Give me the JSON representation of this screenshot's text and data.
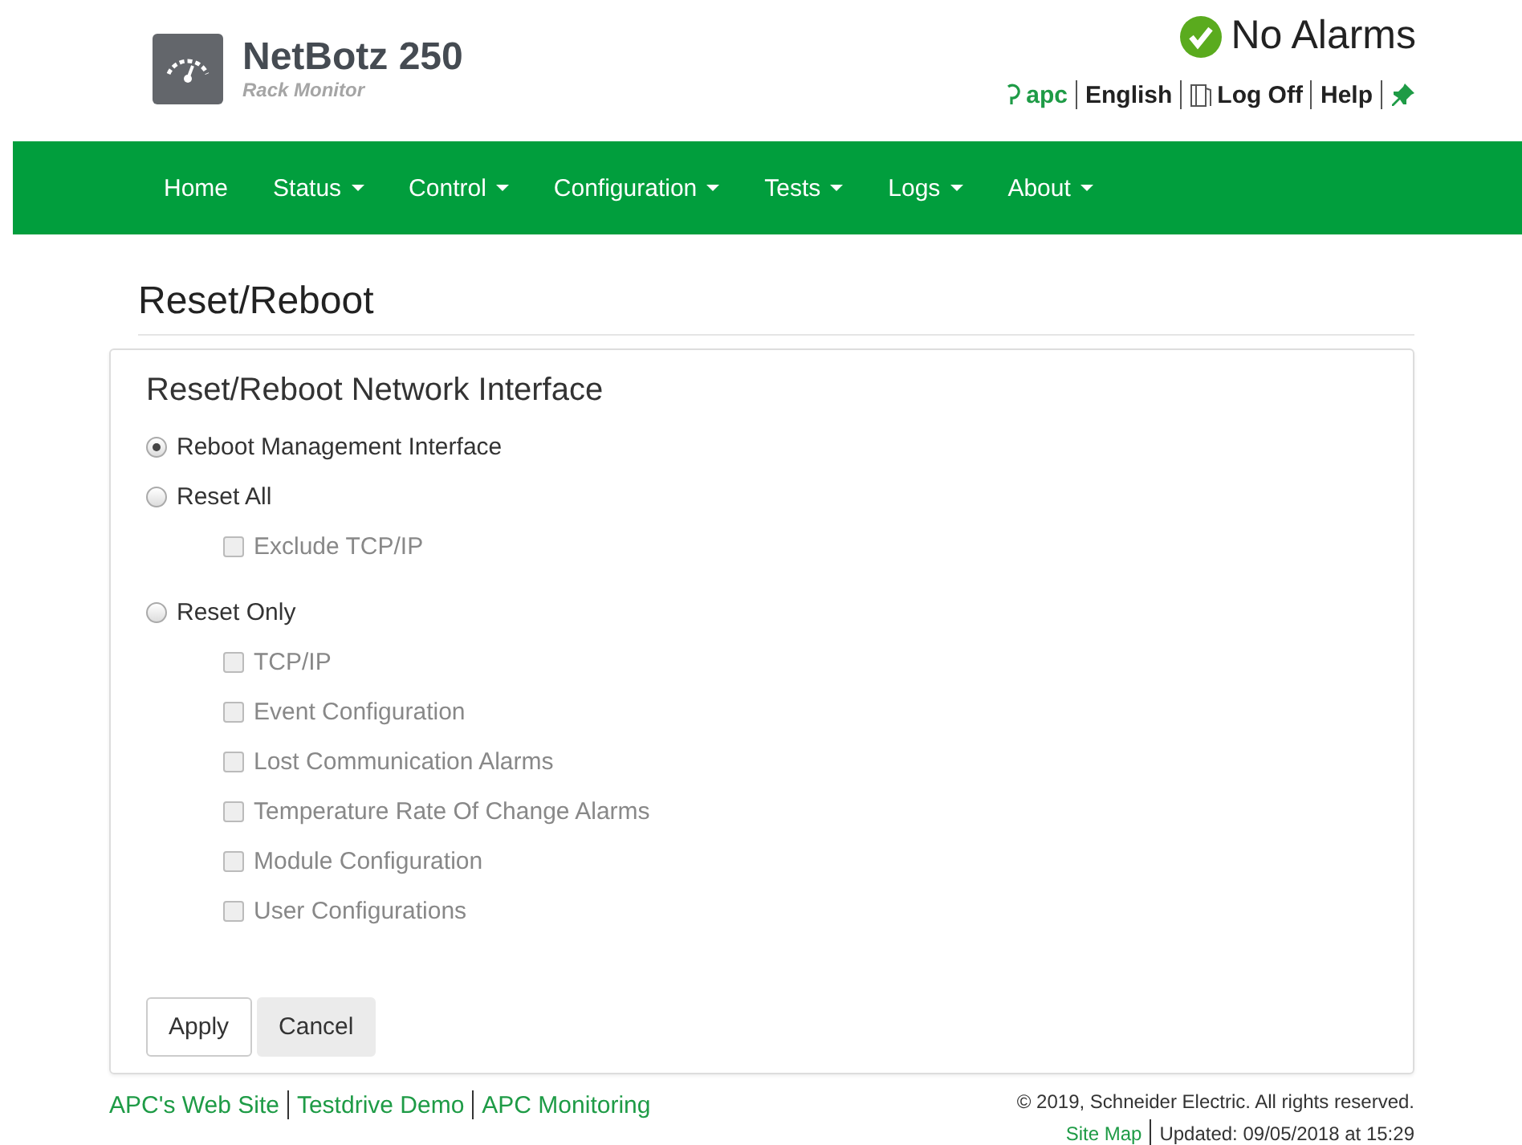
{
  "brand": {
    "product": "NetBotz 250",
    "subtitle": "Rack Monitor"
  },
  "status": {
    "text": "No Alarms"
  },
  "user_links": [
    {
      "kind": "user",
      "label": "apc"
    },
    {
      "kind": "plain",
      "label": "English"
    },
    {
      "kind": "logoff",
      "label": "Log Off"
    },
    {
      "kind": "plain",
      "label": "Help"
    },
    {
      "kind": "pin"
    }
  ],
  "nav": [
    {
      "label": "Home",
      "dropdown": false
    },
    {
      "label": "Status",
      "dropdown": true
    },
    {
      "label": "Control",
      "dropdown": true
    },
    {
      "label": "Configuration",
      "dropdown": true
    },
    {
      "label": "Tests",
      "dropdown": true
    },
    {
      "label": "Logs",
      "dropdown": true
    },
    {
      "label": "About",
      "dropdown": true
    }
  ],
  "page_title": "Reset/Reboot",
  "panel": {
    "title": "Reset/Reboot Network Interface",
    "options": [
      {
        "label": "Reboot Management Interface",
        "selected": true
      },
      {
        "label": "Reset All",
        "selected": false,
        "children": [
          {
            "label": "Exclude TCP/IP",
            "checked": false,
            "disabled": true
          }
        ]
      },
      {
        "label": "Reset Only",
        "selected": false,
        "children": [
          {
            "label": "TCP/IP",
            "checked": false,
            "disabled": true
          },
          {
            "label": "Event Configuration",
            "checked": false,
            "disabled": true
          },
          {
            "label": "Lost Communication Alarms",
            "checked": false,
            "disabled": true
          },
          {
            "label": "Temperature Rate Of Change Alarms",
            "checked": false,
            "disabled": true
          },
          {
            "label": "Module Configuration",
            "checked": false,
            "disabled": true
          },
          {
            "label": "User Configurations",
            "checked": false,
            "disabled": true
          }
        ]
      }
    ],
    "buttons": [
      {
        "label": "Apply",
        "kind": "default"
      },
      {
        "label": "Cancel",
        "kind": "secondary"
      }
    ]
  },
  "footer": {
    "links": [
      "APC's Web Site",
      "Testdrive Demo",
      "APC Monitoring"
    ],
    "copyright": "© 2019, Schneider Electric. All rights reserved.",
    "site_map": "Site Map",
    "updated": "Updated: 09/05/2018 at 15:29"
  }
}
